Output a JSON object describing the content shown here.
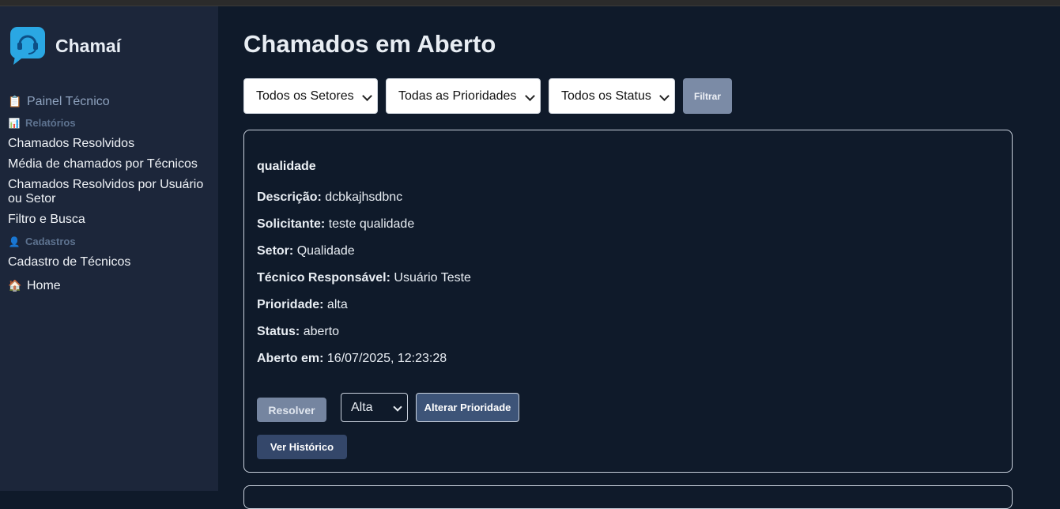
{
  "app": {
    "name": "Chamaí"
  },
  "sidebar": {
    "painel": {
      "emoji": "📋",
      "label": "Painel Técnico"
    },
    "relatorios": {
      "emoji": "📊",
      "label": "Relatórios"
    },
    "items": [
      "Chamados Resolvidos",
      "Média de chamados por Técnicos",
      "Chamados Resolvidos por Usuário ou Setor",
      "Filtro e Busca"
    ],
    "cadastros": {
      "emoji": "👤",
      "label": "Cadastros"
    },
    "cadastro_tecnicos": "Cadastro de Técnicos",
    "home": {
      "emoji": "🏠",
      "label": "Home"
    }
  },
  "main": {
    "title": "Chamados em Aberto",
    "filters": {
      "setor": "Todos os Setores",
      "prioridade": "Todas as Prioridades",
      "status": "Todos os Status",
      "button": "Filtrar"
    }
  },
  "ticket": {
    "title": "qualidade",
    "fields": [
      {
        "label": "Descrição:",
        "value": "dcbkajhsdbnc"
      },
      {
        "label": "Solicitante:",
        "value": "teste qualidade"
      },
      {
        "label": "Setor:",
        "value": "Qualidade"
      },
      {
        "label": "Técnico Responsável:",
        "value": "Usuário Teste"
      },
      {
        "label": "Prioridade:",
        "value": "alta"
      },
      {
        "label": "Status:",
        "value": "aberto"
      },
      {
        "label": "Aberto em:",
        "value": "16/07/2025, 12:23:28"
      }
    ],
    "resolver": "Resolver",
    "priority_select": "Alta",
    "alterar": "Alterar Prioridade",
    "historico": "Ver Histórico"
  },
  "colors": {
    "background": "#0f1a2a",
    "sidebar": "#1c263a",
    "accent": "#3d5478",
    "logo": "#2aa7e3"
  }
}
